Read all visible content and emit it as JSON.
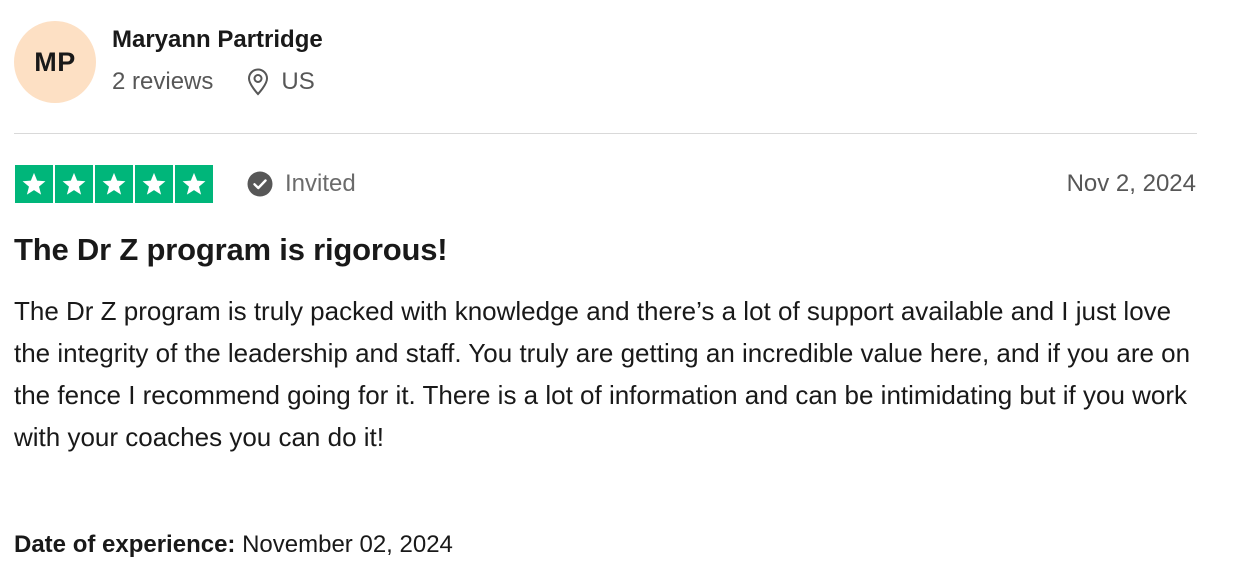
{
  "reviewer": {
    "initials": "MP",
    "name": "Maryann Partridge",
    "reviews_count": "2 reviews",
    "country": "US"
  },
  "rating": {
    "stars": 5,
    "max_stars": 5,
    "star_color": "#00b67a",
    "badge_icon": "check-circle-icon",
    "badge_label": "Invited"
  },
  "review": {
    "date": "Nov 2, 2024",
    "title": "The Dr Z program is rigorous!",
    "text": "The Dr Z program is truly packed with knowledge and there’s a lot of support available and I just love the integrity of the leadership and staff. You truly are getting an incredible value here, and if you are on the fence I recommend going for it. There is a lot of information and can be intimidating but if you work with your coaches you can do it!",
    "experience_label": "Date of experience:",
    "experience_date": "November 02, 2024"
  },
  "colors": {
    "avatar_bg": "#fde0c4",
    "text_primary": "#191919",
    "text_secondary": "#575757"
  }
}
